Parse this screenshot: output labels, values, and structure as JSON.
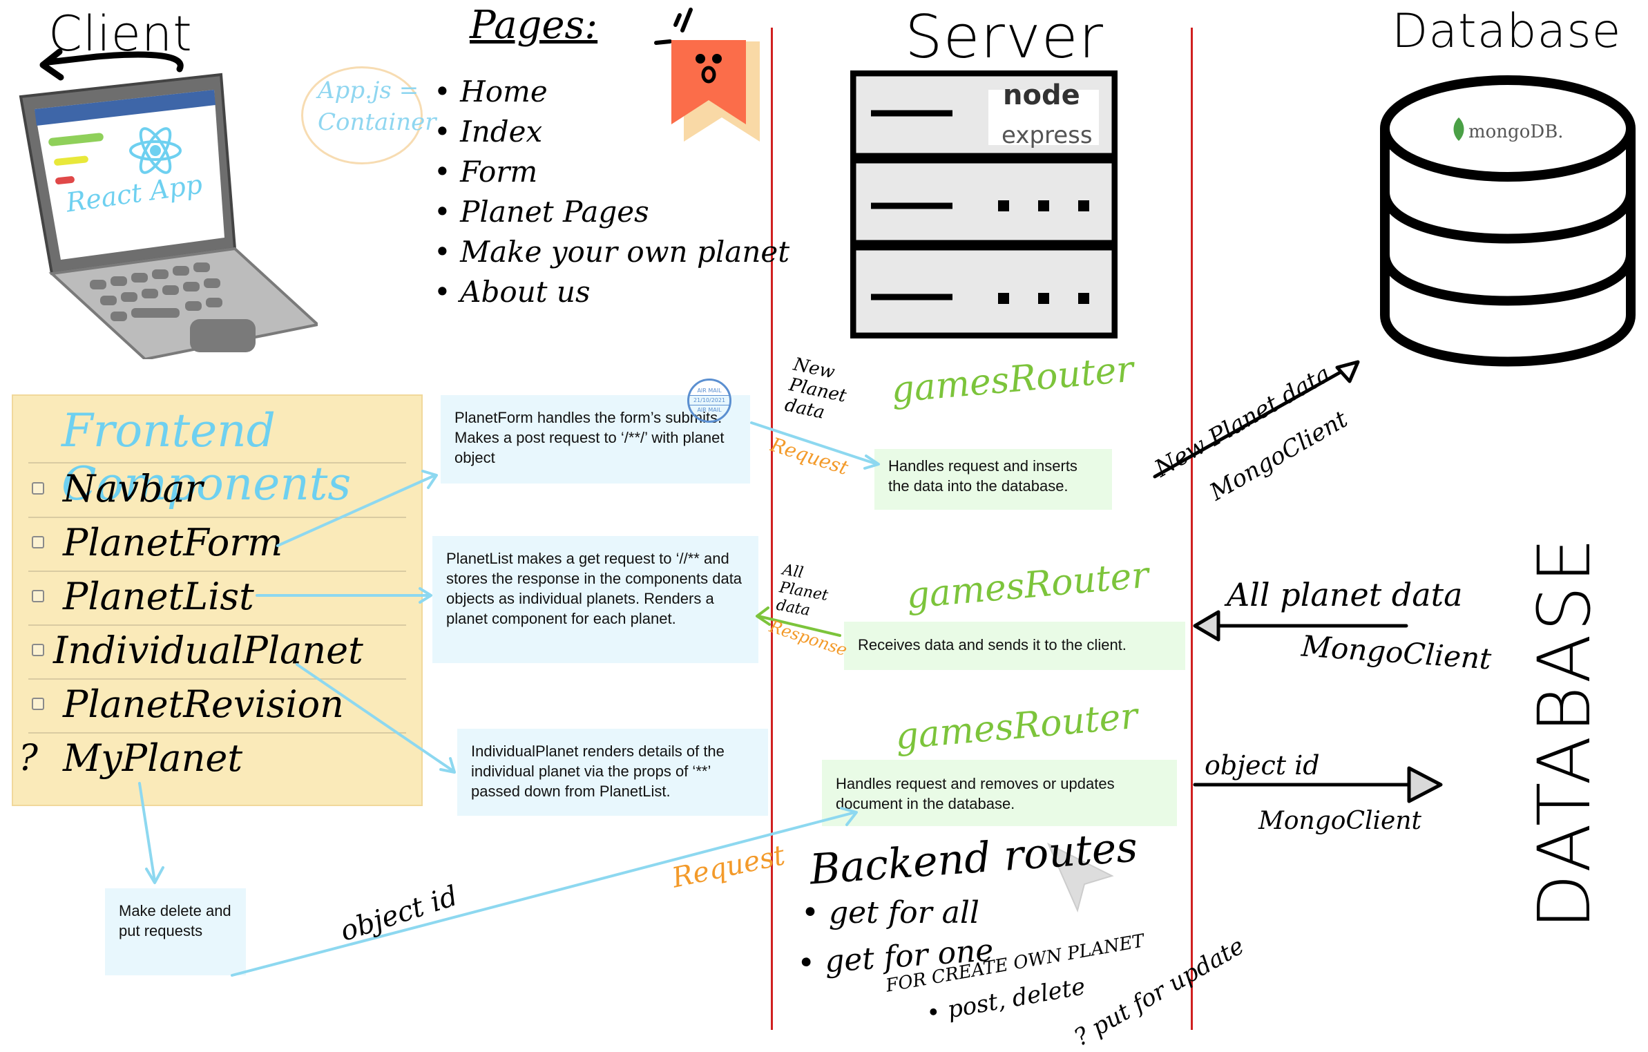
{
  "client": {
    "title": "Client",
    "screen_text": "React App"
  },
  "app_js_note": {
    "line1": "App.js =",
    "line2": "Container"
  },
  "pages": {
    "title": "Pages:",
    "items": [
      "Home",
      "Index",
      "Form",
      "Planet Pages",
      "Make your own planet",
      "About us"
    ]
  },
  "server": {
    "title": "Server",
    "logo_node": "node",
    "logo_express": "express"
  },
  "database": {
    "title": "Database",
    "logo": "mongoDB.",
    "vertical_label": "DATABASE"
  },
  "frontend_components": {
    "title": "Frontend Components",
    "items": [
      "Navbar",
      "PlanetForm",
      "PlanetList",
      "IndividualPlanet",
      "PlanetRevision",
      "MyPlanet"
    ],
    "myplanet_marker": "?"
  },
  "notes": {
    "planetform": "PlanetForm handles the form’s submits. Makes a post request to ‘/**/’ with planet object",
    "planetlist": "PlanetList makes a get request to ‘//** and stores the response in the components data objects as individual planets. Renders a planet component for each planet.",
    "individualplanet": "IndividualPlanet renders details of the individual planet via the props of ‘**’ passed down from PlanetList.",
    "delete_put": "Make delete and put requests",
    "post_handler": "Handles request and inserts the data into the database.",
    "get_handler": "Receives data and sends it to the client.",
    "delete_handler": "Handles request and removes or updates document in the database."
  },
  "stamp": {
    "top": "AIR MAIL",
    "date": "21/10/2021",
    "bottom": "AIR MAIL"
  },
  "router": {
    "label": "gamesRouter"
  },
  "labels": {
    "new_planet_data": "New Planet data",
    "request": "Request",
    "all_planet_data": "All Planet data",
    "response": "Response",
    "object_id": "object id",
    "db_new_planet": "New Planet data",
    "db_mongo_client_1": "MongoClient",
    "db_all_planet": "All planet data",
    "db_mongo_client_2": "MongoClient",
    "db_object_id": "object id",
    "db_mongo_client_3": "MongoClient"
  },
  "backend_routes": {
    "title": "Backend routes",
    "item1": "get for all",
    "item2": "get for one",
    "create_caption": "FOR CREATE OWN PLANET",
    "item3": "post, delete",
    "item4": "? put for update"
  },
  "colors": {
    "divider": "#d02020",
    "router_green": "#7cc43b",
    "request_orange": "#f39a2a",
    "arrow_blue": "#8dd8f0",
    "react_blue": "#6ed0f0"
  }
}
